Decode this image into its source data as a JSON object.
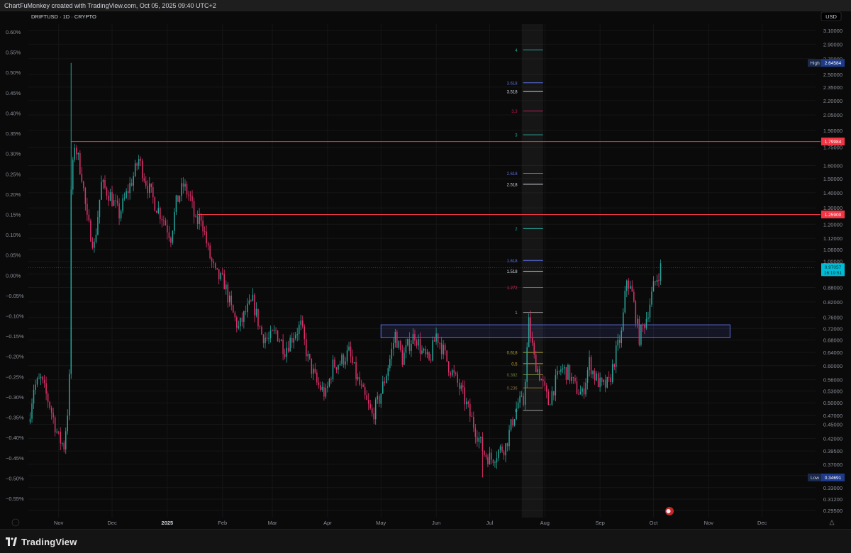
{
  "header": {
    "attribution": "ChartFuMonkey created with TradingView.com, Oct 05, 2025 09:40 UTC+2"
  },
  "footer": {
    "brand": "TradingView"
  },
  "colors": {
    "background": "#0a0a0a",
    "up": "#26a69a",
    "down": "#e0306a",
    "level": "#f23645",
    "box": "#5b6ee1",
    "grid": "#161616",
    "axis_text": "#8a8f98",
    "high_badge": "#2962ff",
    "price_badge": "#00bcd4"
  },
  "chart_data": {
    "type": "candlestick",
    "symbol_label": "DRIFTUSD · 1D · CRYPTO",
    "currency_label": "USD",
    "scale": "log",
    "ylim": [
      0.285,
      3.2
    ],
    "right_ticks": [
      "3.10000",
      "2.90000",
      "2.70000",
      "2.50000",
      "2.35000",
      "2.20000",
      "2.05000",
      "1.90000",
      "1.75000",
      "1.60000",
      "1.50000",
      "1.40000",
      "1.30000",
      "1.20000",
      "1.12000",
      "1.06000",
      "1.00000",
      "0.94000",
      "0.88000",
      "0.82000",
      "0.76000",
      "0.72000",
      "0.68000",
      "0.64000",
      "0.60000",
      "0.56000",
      "0.53000",
      "0.50000",
      "0.47000",
      "0.45000",
      "0.42000",
      "0.39500",
      "0.37000",
      "0.35000",
      "0.33000",
      "0.31200",
      "0.29500"
    ],
    "left_ticks": [
      "0.60%",
      "0.55%",
      "0.50%",
      "0.45%",
      "0.40%",
      "0.35%",
      "0.30%",
      "0.25%",
      "0.20%",
      "0.15%",
      "0.10%",
      "0.05%",
      "0.00%",
      "−0.05%",
      "−0.10%",
      "−0.15%",
      "−0.20%",
      "−0.25%",
      "−0.30%",
      "−0.35%",
      "−0.40%",
      "−0.45%",
      "−0.50%",
      "−0.55%"
    ],
    "x_ticks": [
      "Nov",
      "Dec",
      "2025",
      "Feb",
      "Mar",
      "Apr",
      "May",
      "Jun",
      "Jul",
      "Aug",
      "Sep",
      "Oct",
      "Nov",
      "Dec"
    ],
    "x_start": "2024-10-15",
    "x_end": "2025-12-31",
    "high": {
      "label": "High",
      "value": "2.64584"
    },
    "low": {
      "label": "Low",
      "value": "0.34691"
    },
    "last_price": {
      "value": "0.97057",
      "countdown": "16:19:51"
    },
    "horizontal_levels": [
      {
        "value": 1.79984,
        "label": "1.79984",
        "start": "2024-11-08"
      },
      {
        "value": 1.259,
        "label": "1.25900",
        "start": "2025-01-18"
      }
    ],
    "zone": {
      "start": "2025-05-01",
      "end": "2025-11-13",
      "top": 0.733,
      "bottom": 0.688
    },
    "fib_extension": {
      "start": "2025-07-19",
      "end": "2025-07-31",
      "levels": [
        {
          "ratio": "0",
          "price": 0.482,
          "color": "#9e9e9e"
        },
        {
          "ratio": "0.236",
          "price": 0.538,
          "color": "#8a6d3b"
        },
        {
          "ratio": "0.382",
          "price": 0.574,
          "color": "#6e7d3a"
        },
        {
          "ratio": "0.5",
          "price": 0.606,
          "color": "#c9a227"
        },
        {
          "ratio": "0.618",
          "price": 0.64,
          "color": "#a8a23a"
        },
        {
          "ratio": "1",
          "price": 0.779,
          "color": "#9e9e9e"
        },
        {
          "ratio": "1.272",
          "price": 0.88,
          "color": "#e0306a"
        },
        {
          "ratio": "1.518",
          "price": 0.953,
          "color": "#d1d4dc"
        },
        {
          "ratio": "1.618",
          "price": 1.005,
          "color": "#5b6ee1"
        },
        {
          "ratio": "2",
          "price": 1.175,
          "color": "#26a69a"
        },
        {
          "ratio": "2.518",
          "price": 1.46,
          "color": "#d1d4dc"
        },
        {
          "ratio": "2.618",
          "price": 1.54,
          "color": "#5b6ee1"
        },
        {
          "ratio": "3",
          "price": 1.86,
          "color": "#26a69a"
        },
        {
          "ratio": "3.3",
          "price": 2.09,
          "color": "#c2185b"
        },
        {
          "ratio": "3.518",
          "price": 2.3,
          "color": "#d1d4dc"
        },
        {
          "ratio": "3.618",
          "price": 2.4,
          "color": "#5b6ee1"
        },
        {
          "ratio": "4",
          "price": 2.82,
          "color": "#26a69a"
        }
      ]
    },
    "price_path": [
      [
        "2024-10-15",
        0.455
      ],
      [
        "2024-10-18",
        0.54
      ],
      [
        "2024-10-22",
        0.56
      ],
      [
        "2024-10-27",
        0.495
      ],
      [
        "2024-11-01",
        0.42
      ],
      [
        "2024-11-04",
        0.405
      ],
      [
        "2024-11-06",
        0.48
      ],
      [
        "2024-11-07",
        0.56
      ],
      [
        "2024-11-08",
        1.42
      ],
      [
        "2024-11-10",
        1.78
      ],
      [
        "2024-11-14",
        1.53
      ],
      [
        "2024-11-17",
        1.22
      ],
      [
        "2024-11-21",
        1.08
      ],
      [
        "2024-11-25",
        1.46
      ],
      [
        "2024-11-30",
        1.38
      ],
      [
        "2024-12-05",
        1.26
      ],
      [
        "2024-12-10",
        1.42
      ],
      [
        "2024-12-13",
        1.52
      ],
      [
        "2024-12-16",
        1.65
      ],
      [
        "2024-12-20",
        1.48
      ],
      [
        "2024-12-25",
        1.33
      ],
      [
        "2024-12-30",
        1.23
      ],
      [
        "2025-01-03",
        1.13
      ],
      [
        "2025-01-06",
        1.33
      ],
      [
        "2025-01-10",
        1.45
      ],
      [
        "2025-01-14",
        1.36
      ],
      [
        "2025-01-17",
        1.2
      ],
      [
        "2025-01-20",
        1.25
      ],
      [
        "2025-01-24",
        1.05
      ],
      [
        "2025-01-28",
        0.94
      ],
      [
        "2025-02-02",
        0.9
      ],
      [
        "2025-02-06",
        0.79
      ],
      [
        "2025-02-10",
        0.72
      ],
      [
        "2025-02-14",
        0.78
      ],
      [
        "2025-02-18",
        0.82
      ],
      [
        "2025-02-23",
        0.7
      ],
      [
        "2025-02-27",
        0.68
      ],
      [
        "2025-03-03",
        0.71
      ],
      [
        "2025-03-08",
        0.65
      ],
      [
        "2025-03-13",
        0.7
      ],
      [
        "2025-03-17",
        0.73
      ],
      [
        "2025-03-21",
        0.62
      ],
      [
        "2025-03-26",
        0.55
      ],
      [
        "2025-03-31",
        0.52
      ],
      [
        "2025-04-04",
        0.6
      ],
      [
        "2025-04-08",
        0.61
      ],
      [
        "2025-04-13",
        0.64
      ],
      [
        "2025-04-17",
        0.57
      ],
      [
        "2025-04-22",
        0.51
      ],
      [
        "2025-04-26",
        0.47
      ],
      [
        "2025-04-30",
        0.51
      ],
      [
        "2025-05-03",
        0.56
      ],
      [
        "2025-05-06",
        0.62
      ],
      [
        "2025-05-09",
        0.7
      ],
      [
        "2025-05-13",
        0.62
      ],
      [
        "2025-05-16",
        0.66
      ],
      [
        "2025-05-20",
        0.7
      ],
      [
        "2025-05-24",
        0.64
      ],
      [
        "2025-05-28",
        0.61
      ],
      [
        "2025-06-01",
        0.7
      ],
      [
        "2025-06-04",
        0.66
      ],
      [
        "2025-06-08",
        0.6
      ],
      [
        "2025-06-12",
        0.56
      ],
      [
        "2025-06-16",
        0.52
      ],
      [
        "2025-06-20",
        0.47
      ],
      [
        "2025-06-24",
        0.43
      ],
      [
        "2025-06-28",
        0.39
      ],
      [
        "2025-07-02",
        0.38
      ],
      [
        "2025-07-06",
        0.395
      ],
      [
        "2025-07-10",
        0.405
      ],
      [
        "2025-07-14",
        0.46
      ],
      [
        "2025-07-17",
        0.5
      ],
      [
        "2025-07-20",
        0.5
      ],
      [
        "2025-07-23",
        0.74
      ],
      [
        "2025-07-26",
        0.62
      ],
      [
        "2025-07-30",
        0.56
      ],
      [
        "2025-08-03",
        0.5
      ],
      [
        "2025-08-06",
        0.54
      ],
      [
        "2025-08-10",
        0.59
      ],
      [
        "2025-08-14",
        0.58
      ],
      [
        "2025-08-18",
        0.54
      ],
      [
        "2025-08-22",
        0.52
      ],
      [
        "2025-08-26",
        0.61
      ],
      [
        "2025-08-29",
        0.57
      ],
      [
        "2025-09-02",
        0.54
      ],
      [
        "2025-09-06",
        0.55
      ],
      [
        "2025-09-10",
        0.64
      ],
      [
        "2025-09-13",
        0.7
      ],
      [
        "2025-09-16",
        0.92
      ],
      [
        "2025-09-19",
        0.85
      ],
      [
        "2025-09-23",
        0.69
      ],
      [
        "2025-09-27",
        0.76
      ],
      [
        "2025-10-01",
        0.88
      ],
      [
        "2025-10-05",
        0.97
      ]
    ]
  }
}
